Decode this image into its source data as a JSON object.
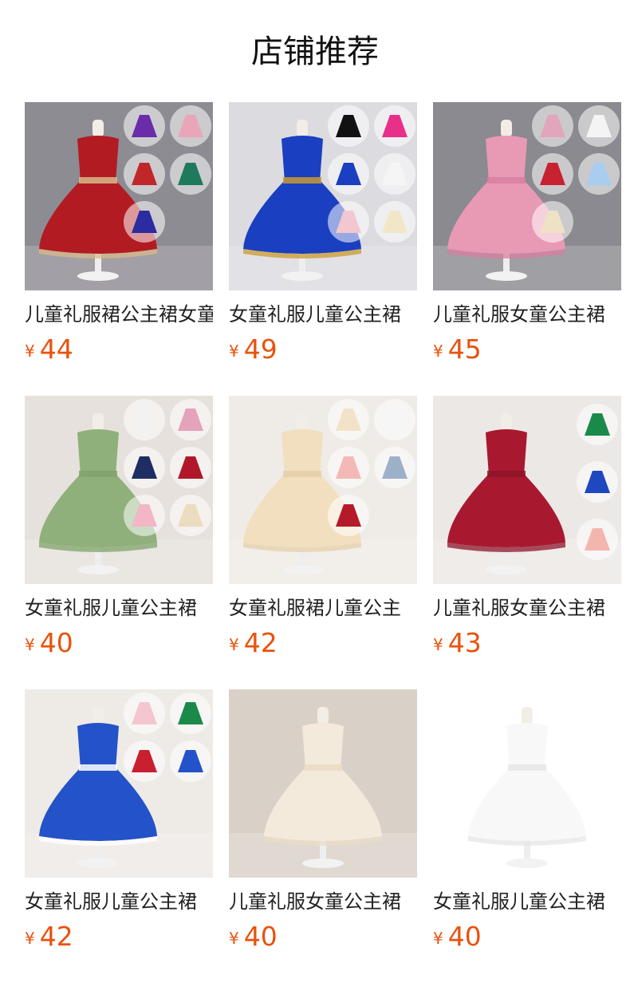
{
  "header": {
    "title": "店铺推荐"
  },
  "currency_symbol": "¥",
  "products": [
    {
      "name": "儿童礼服裙公主裙女童",
      "price": "44",
      "bg": "#8e8c93",
      "dress": "#b21b22",
      "accent": "#d8b98a",
      "swatches": [
        "#6a2ca8",
        "#e8a6b8",
        "#c0262a",
        "#1e7a5a",
        "#2a2ca0"
      ]
    },
    {
      "name": "女童礼服儿童公主裙",
      "price": "49",
      "bg": "#dcdbe0",
      "dress": "#1a3fc0",
      "accent": "#c99a2e",
      "swatches": [
        "#111111",
        "#e82f8a",
        "#1a3fc0",
        "#f5f5f5",
        "#f3c7cf",
        "#f2e6c8"
      ]
    },
    {
      "name": "儿童礼服女童公主裙",
      "price": "45",
      "bg": "#8a8a90",
      "dress": "#e899b4",
      "accent": "#d97ea0",
      "swatches": [
        "#e1a6bb",
        "#f4f4f4",
        "#c8212f",
        "#a8cdef",
        "#efe1c6"
      ]
    },
    {
      "name": "女童礼服儿童公主裙",
      "price": "40",
      "bg": "#e6e1dc",
      "dress": "#8fb07a",
      "accent": "#7fa36a",
      "swatches": [
        "#f2f2f2",
        "#e4a2bb",
        "#1e2d63",
        "#b0182a",
        "#f2b6c6",
        "#ecdcc0"
      ]
    },
    {
      "name": "女童礼服裙儿童公主",
      "price": "42",
      "bg": "#efebe6",
      "dress": "#f1dfc0",
      "accent": "#e5cfa9",
      "swatches": [
        "#f2e3c8",
        "#f6f6f6",
        "#f4b9b6",
        "#9db0c9",
        "#b51a2a"
      ]
    },
    {
      "name": "儿童礼服女童公主裙",
      "price": "43",
      "bg": "#ece8e6",
      "dress": "#a81930",
      "accent": "#8e1428",
      "swatches": [
        "#1a8a4a",
        "#1f47c0",
        "#f3b6ae"
      ]
    },
    {
      "name": "女童礼服儿童公主裙",
      "price": "42",
      "bg": "#eeeae6",
      "dress": "#2452c8",
      "accent": "#ffffff",
      "swatches": [
        "#f4c6cf",
        "#1a8a4a",
        "#c8202e",
        "#2452c8"
      ]
    },
    {
      "name": "儿童礼服女童公主裙",
      "price": "40",
      "bg": "#d9d1c7",
      "dress": "#f4eadb",
      "accent": "#e9dcc6",
      "swatches": []
    },
    {
      "name": "女童礼服儿童公主裙",
      "price": "40",
      "bg": "#ffffff",
      "dress": "#f8f8f8",
      "accent": "#e6e6e6",
      "swatches": []
    }
  ]
}
